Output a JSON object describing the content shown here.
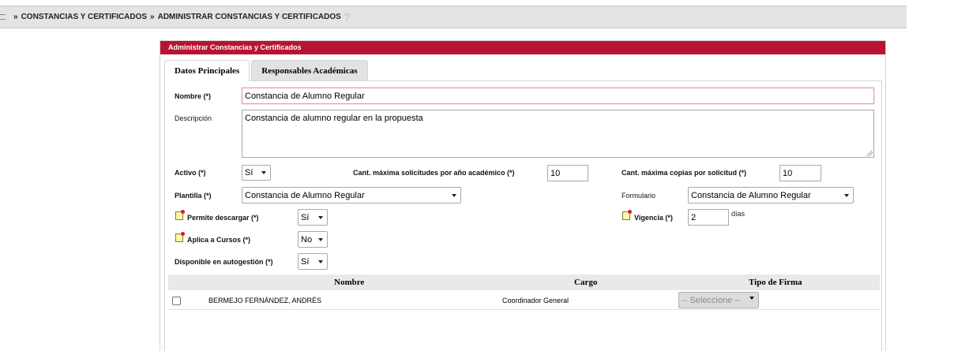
{
  "breadcrumb": {
    "items": [
      "CONSTANCIAS Y CERTIFICADOS",
      "ADMINISTRAR CONSTANCIAS Y CERTIFICADOS"
    ],
    "separator": "»",
    "help": "?"
  },
  "panel": {
    "title": "Administrar Constancias y Certificados",
    "tabs": [
      "Datos Principales",
      "Responsables Académicas"
    ]
  },
  "form": {
    "nombre_label": "Nombre (*)",
    "nombre_value": "Constancia de Alumno Regular",
    "descripcion_label": "Descripción",
    "descripcion_value": "Constancia de alumno regular en la propuesta",
    "activo_label": "Activo (*)",
    "activo_value": "Sí",
    "cant_solicitudes_label": "Cant. máxima solicitudes por año académico (*)",
    "cant_solicitudes_value": "10",
    "cant_copias_label": "Cant. máxima copias por solicitud (*)",
    "cant_copias_value": "10",
    "plantilla_label": "Plantilla (*)",
    "plantilla_value": "Constancia de Alumno Regular",
    "formulario_label": "Formulario",
    "formulario_value": "Constancia de Alumno Regular",
    "permite_descargar_label": "Permite descargar (*)",
    "permite_descargar_value": "Sí",
    "vigencia_label": "Vigencia (*)",
    "vigencia_value": "2",
    "vigencia_unit": "días",
    "aplica_cursos_label": "Aplica a Cursos (*)",
    "aplica_cursos_value": "No",
    "autogestion_label": "Disponible en autogestión (*)",
    "autogestion_value": "Sí"
  },
  "firmantes": {
    "columns": [
      "Nombre",
      "Cargo",
      "Tipo de Firma"
    ],
    "rows": [
      {
        "nombre": "BERMEJO FERNÁNDEZ, ANDRÉS",
        "cargo": "Coordinador General",
        "tipo_firma": "-- Seleccione --"
      }
    ]
  },
  "colors": {
    "header_bg": "#b81432",
    "breadcrumb_bg": "#e4e4e4"
  },
  "icons": {
    "note": "note-icon",
    "help": "help-icon",
    "menu": "menu-icon"
  }
}
